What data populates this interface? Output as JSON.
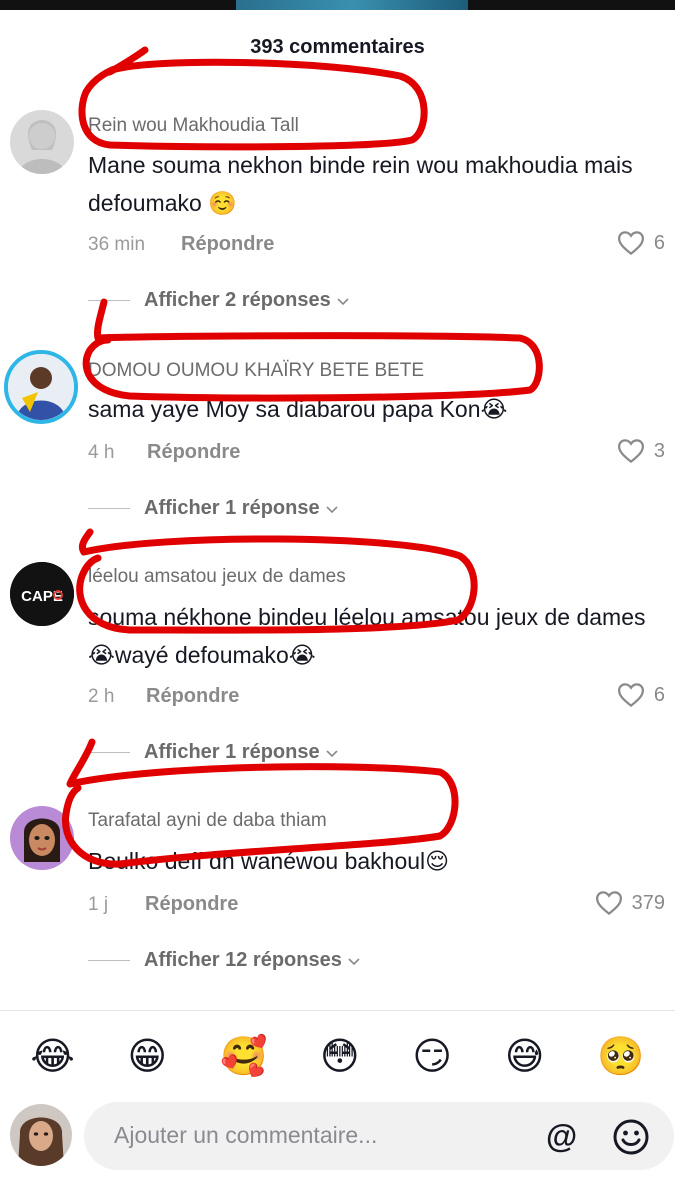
{
  "header": {
    "title": "393 commentaires"
  },
  "comments": [
    {
      "username": "Rein wou Makhoudia Tall",
      "text": "Mane souma nekhon binde rein wou makhoudia mais defoumako ☺️",
      "time": "36 min",
      "reply_label": "Répondre",
      "likes": "6",
      "replies_label": "Afficher 2 réponses"
    },
    {
      "username": "DOMOU OUMOU KHAÏRY BETE BETE",
      "text": "sama yaye Moy sa diabarou papa Kon😭",
      "time": "4 h",
      "reply_label": "Répondre",
      "likes": "3",
      "replies_label": "Afficher 1 réponse"
    },
    {
      "username": "léelou amsatou jeux de dames",
      "text": "souma nékhone bindeu léelou amsatou jeux de dames 😭wayé defoumako😭",
      "time": "2 h",
      "reply_label": "Répondre",
      "likes": "6",
      "replies_label": "Afficher 1 réponse",
      "avatar_text": "CAPE"
    },
    {
      "username": "Tarafatal ayni de daba thiam",
      "text": "Boulko deff dh wanéwou bakhoul😌",
      "time": "1 j",
      "reply_label": "Répondre",
      "likes": "379",
      "replies_label": "Afficher 12 réponses"
    }
  ],
  "emoji_bar": [
    "😂",
    "😁",
    "🥰",
    "😳",
    "😏",
    "😅",
    "🥺"
  ],
  "composer": {
    "placeholder": "Ajouter un commentaire...",
    "at_label": "@"
  },
  "colors": {
    "annotation": "#e00000",
    "text_primary": "#161823",
    "text_secondary": "#8a8a8a"
  }
}
